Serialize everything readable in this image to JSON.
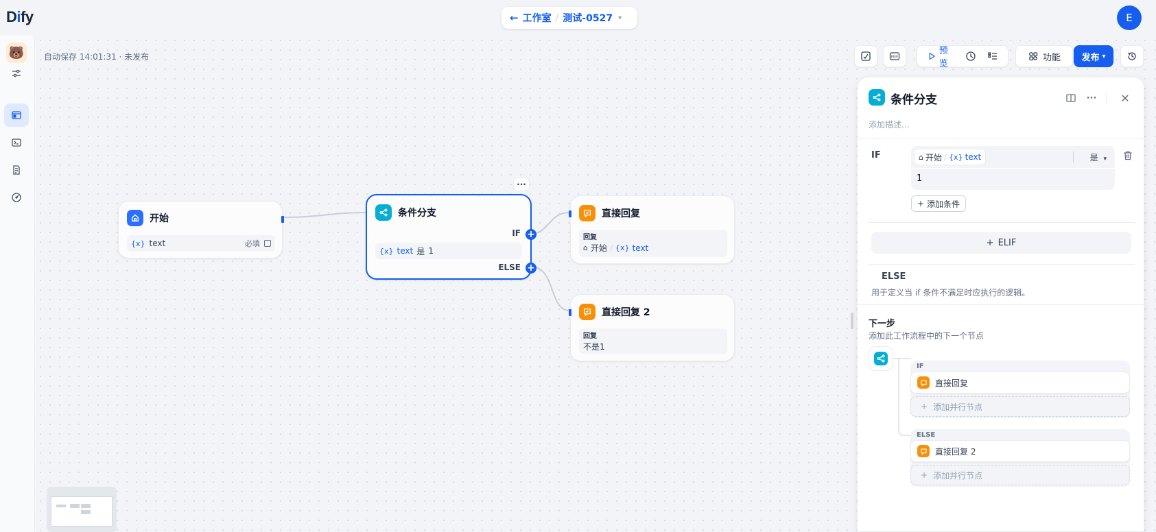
{
  "header": {
    "logo_prefix": "D",
    "logo_ai": "i",
    "logo_suffix": "fy",
    "back_arrow": "←",
    "studio": "工作室",
    "separator": "/",
    "app_name": "测试-0527",
    "chevron": "⌄",
    "avatar_letter": "E"
  },
  "sidebar": {
    "app_icon": "🐻",
    "items": [
      "settings-icon",
      "workflow-icon",
      "terminal-icon",
      "logs-icon",
      "monitor-icon"
    ]
  },
  "canvas": {
    "autosave": "自动保存 14:01:31 · 未发布"
  },
  "toolbar": {
    "preview": "预览",
    "features": "功能",
    "publish": "发布"
  },
  "nodes": {
    "start": {
      "title": "开始",
      "var_prefix": "{x}",
      "var_name": "text",
      "required": "必填"
    },
    "if_else": {
      "title": "条件分支",
      "if_label": "IF",
      "else_label": "ELSE",
      "cond_var_prefix": "{x}",
      "cond_var": "text",
      "cond_op": "是",
      "cond_val": "1",
      "menu": "···",
      "plus": "+"
    },
    "answer1": {
      "title": "直接回复",
      "reply_label": "回复",
      "ref_node": "开始",
      "ref_sep": "/",
      "ref_var_prefix": "{x}",
      "ref_var": "text"
    },
    "answer2": {
      "title": "直接回复 2",
      "reply_label": "回复",
      "reply_text": "不是1"
    }
  },
  "panel": {
    "title": "条件分支",
    "desc_placeholder": "添加描述...",
    "if_label": "IF",
    "cond_node": "开始",
    "cond_sep": "/",
    "cond_var_prefix": "{x}",
    "cond_var": "text",
    "cond_op": "是",
    "cond_value": "1",
    "add_condition": "添加条件",
    "elif": "ELIF",
    "plus": "+",
    "else_title": "ELSE",
    "else_desc": "用于定义当 if 条件不满足时应执行的逻辑。",
    "next_title": "下一步",
    "next_desc": "添加此工作流程中的下一个节点",
    "branches": [
      {
        "label": "IF",
        "node": "直接回复",
        "add_parallel": "添加并行节点"
      },
      {
        "label": "ELSE",
        "node": "直接回复 2",
        "add_parallel": "添加并行节点"
      }
    ]
  },
  "colors": {
    "accent": "#155eef",
    "start_icon": "#2970ff",
    "if_else_icon": "#06aed4",
    "answer_icon": "#f79009"
  }
}
